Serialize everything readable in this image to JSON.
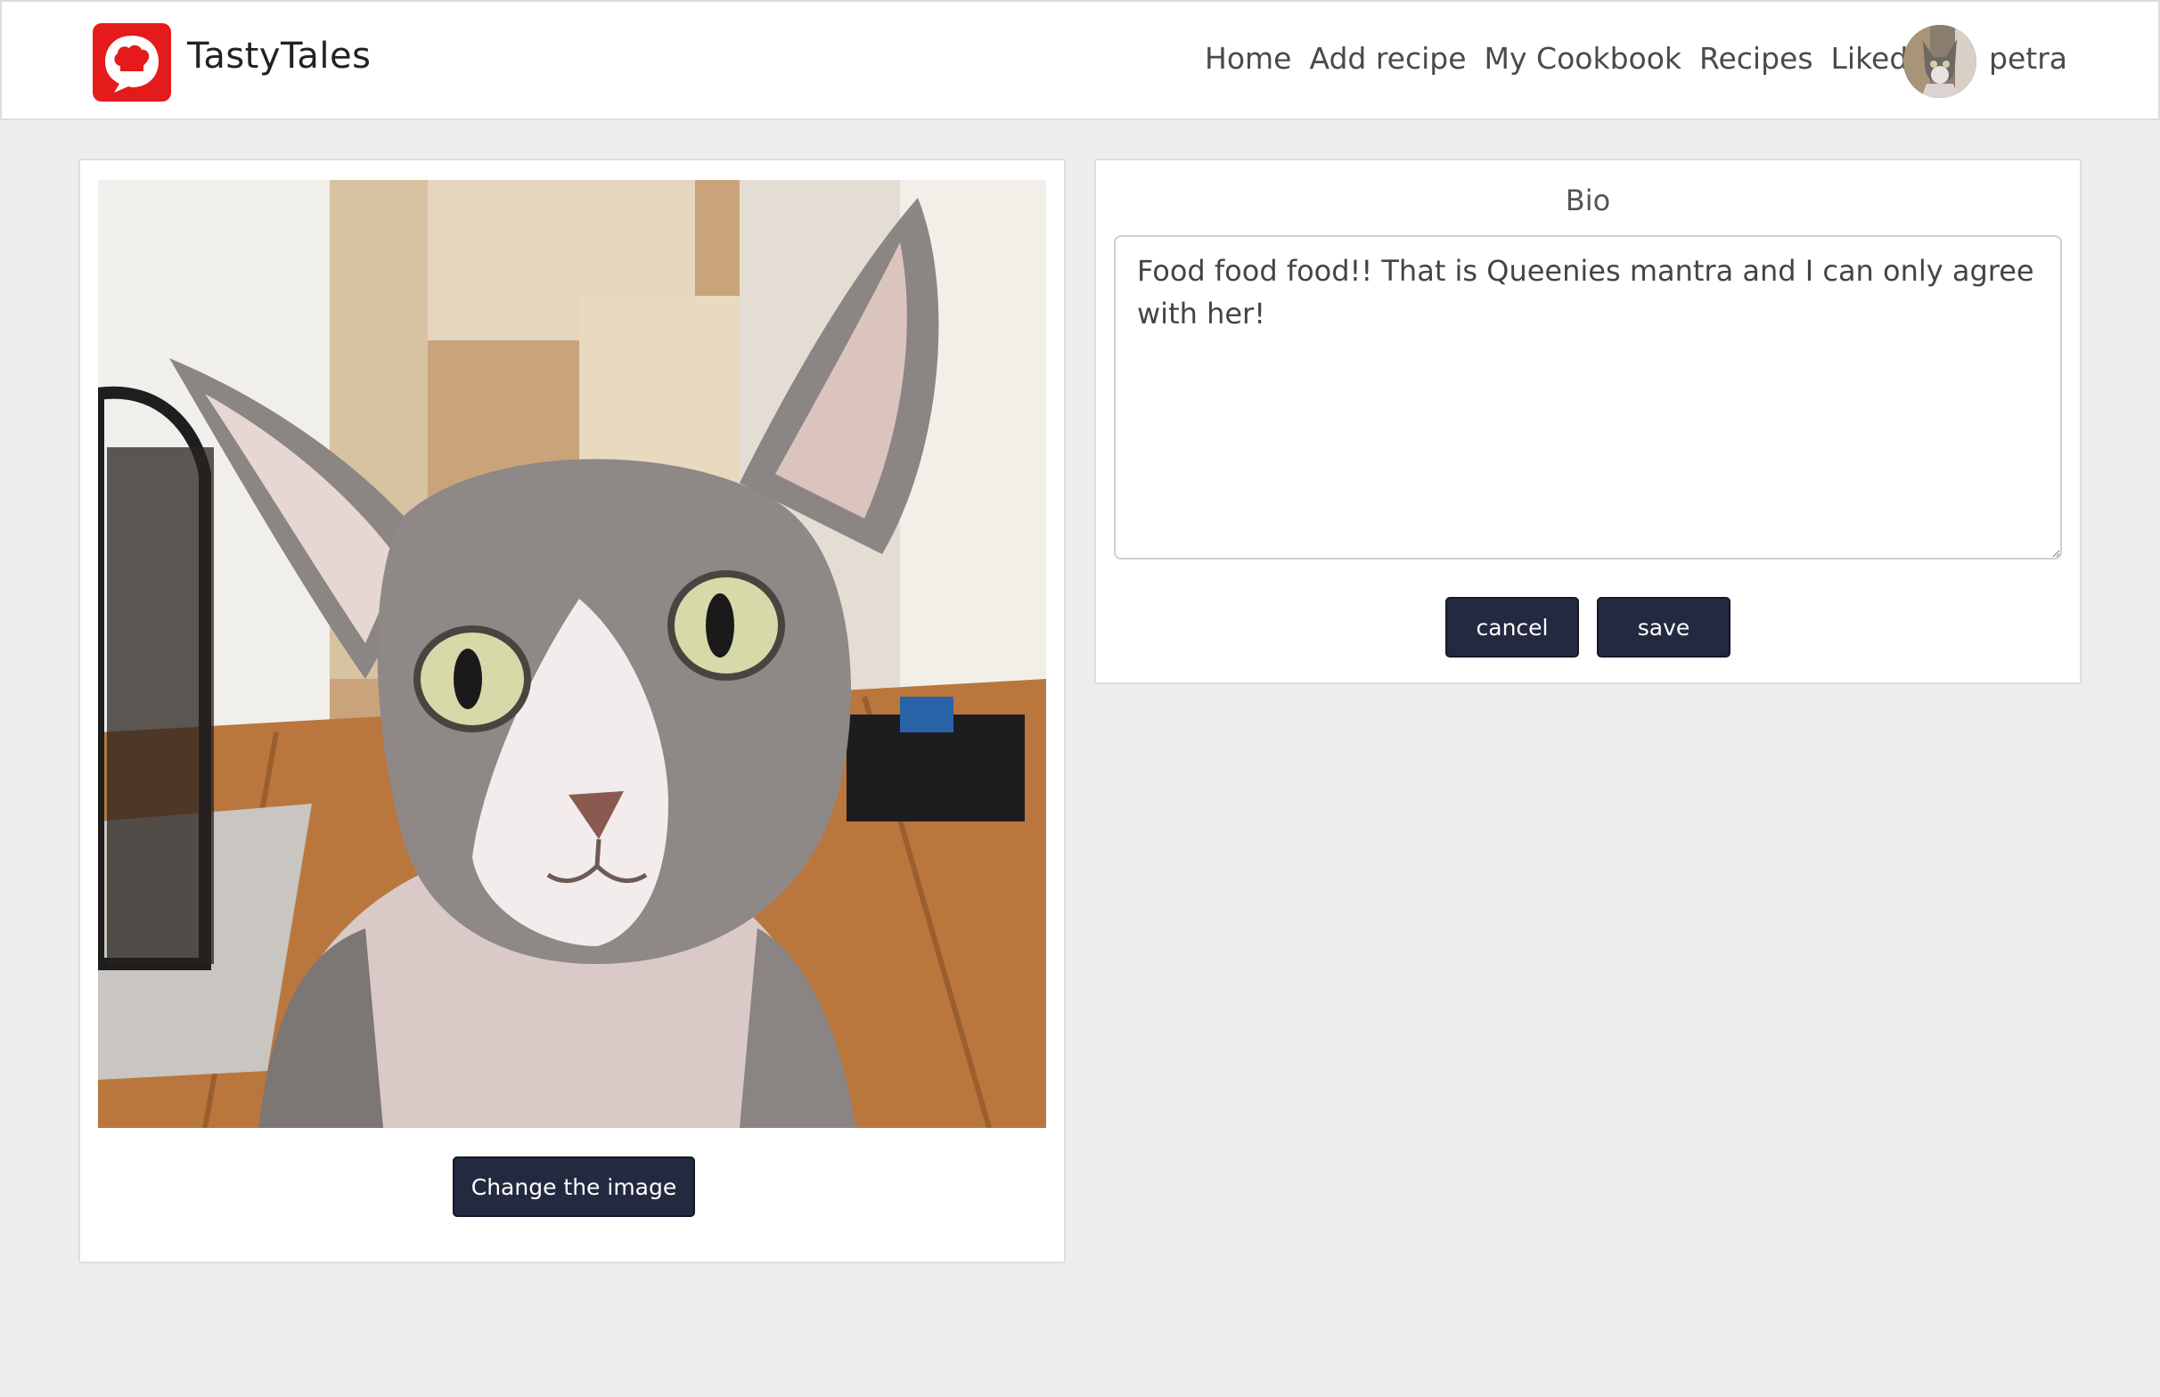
{
  "brand": {
    "name": "TastyTales",
    "logo_icon": "chef-hat-speech-bubble-icon",
    "logo_color": "#e51a1a"
  },
  "nav": {
    "items": [
      {
        "label": "Home"
      },
      {
        "label": "Add recipe"
      },
      {
        "label": "My Cookbook"
      },
      {
        "label": "Recipes"
      },
      {
        "label": "Liked"
      }
    ],
    "username": "petra"
  },
  "profile_image": {
    "change_button_label": "Change the image"
  },
  "bio": {
    "title": "Bio",
    "text": "Food food food!! That is Queenies mantra and I can only agree with her!",
    "cancel_label": "cancel",
    "save_label": "save"
  },
  "colors": {
    "button_bg": "#232a40",
    "page_bg": "#ebeeed"
  }
}
